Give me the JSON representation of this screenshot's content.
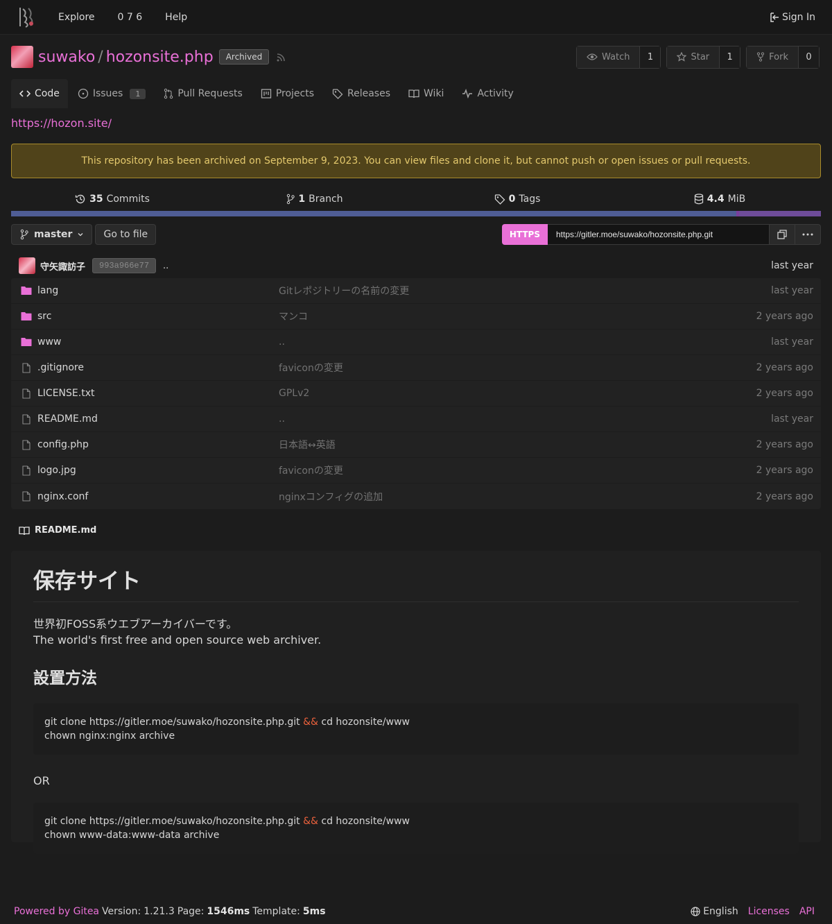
{
  "nav": {
    "explore": "Explore",
    "numbers": "0 7 6",
    "help": "Help",
    "signin": "Sign In"
  },
  "repo": {
    "owner": "suwako",
    "sep": "/",
    "name": "hozonsite.php",
    "archived_badge": "Archived",
    "watch_label": "Watch",
    "watch_count": "1",
    "star_label": "Star",
    "star_count": "1",
    "fork_label": "Fork",
    "fork_count": "0"
  },
  "tabs": [
    {
      "label": "Code",
      "icon": "code-icon"
    },
    {
      "label": "Issues",
      "count": "1",
      "icon": "issue-icon"
    },
    {
      "label": "Pull Requests",
      "icon": "pull-request-icon"
    },
    {
      "label": "Projects",
      "icon": "projects-icon"
    },
    {
      "label": "Releases",
      "icon": "tag-icon"
    },
    {
      "label": "Wiki",
      "icon": "book-icon"
    },
    {
      "label": "Activity",
      "icon": "pulse-icon"
    }
  ],
  "website": "https://hozon.site/",
  "archived_notice": "This repository has been archived on September 9, 2023. You can view files and clone it, but cannot push or open issues or pull requests.",
  "stats": {
    "commits_num": "35",
    "commits_label": "Commits",
    "branch_num": "1",
    "branch_label": "Branch",
    "tags_num": "0",
    "tags_label": "Tags",
    "size_num": "4.4",
    "size_label": "MiB"
  },
  "language_bar": [
    {
      "color": "#4f5d95",
      "fraction": 0.8956
    },
    {
      "color": "#7a3e9d",
      "fraction": 0.0035
    },
    {
      "color": "#6e4c99",
      "fraction": 0.1009
    }
  ],
  "branch": {
    "current": "master",
    "goto_file": "Go to file",
    "protocol": "HTTPS",
    "clone_url": "https://gitler.moe/suwako/hozonsite.php.git"
  },
  "latest_commit": {
    "author": "守矢諏訪子",
    "sha": "993a966e77",
    "message": "..",
    "age": "last year"
  },
  "files": [
    {
      "name": "lang",
      "type": "folder",
      "message": "Gitレポジトリーの名前の変更",
      "age": "last year"
    },
    {
      "name": "src",
      "type": "folder",
      "message": "マンコ",
      "age": "2 years ago"
    },
    {
      "name": "www",
      "type": "folder",
      "message": "..",
      "age": "last year"
    },
    {
      "name": ".gitignore",
      "type": "file",
      "message": "faviconの変更",
      "age": "2 years ago"
    },
    {
      "name": "LICENSE.txt",
      "type": "file",
      "message": "GPLv2",
      "age": "2 years ago"
    },
    {
      "name": "README.md",
      "type": "file",
      "message": "..",
      "age": "last year"
    },
    {
      "name": "config.php",
      "type": "file",
      "message": "日本語↔英語",
      "age": "2 years ago"
    },
    {
      "name": "logo.jpg",
      "type": "file",
      "message": "faviconの変更",
      "age": "2 years ago"
    },
    {
      "name": "nginx.conf",
      "type": "file",
      "message": "nginxコンフィグの追加",
      "age": "2 years ago"
    }
  ],
  "readme": {
    "filename": "README.md",
    "h1": "保存サイト",
    "p_line1": "世界初FOSS系ウエブアーカイバーです。",
    "p_line2": "The world's first free and open source web archiver.",
    "h2": "設置方法",
    "code1": {
      "line1_a": "git clone https://gitler.moe/suwako/hozonsite.php.git ",
      "amp": "&&",
      "line1_b": " cd hozonsite/www",
      "line2": "chown nginx:nginx archive"
    },
    "or": "OR",
    "code2": {
      "line1_a": "git clone https://gitler.moe/suwako/hozonsite.php.git ",
      "amp": "&&",
      "line1_b": " cd hozonsite/www",
      "line2": "chown www-data:www-data archive"
    }
  },
  "footer": {
    "powered": "Powered by Gitea",
    "version_label": "Version:",
    "version": "1.21.3",
    "page_label": "Page:",
    "page_time": "1546ms",
    "template_label": "Template:",
    "template_time": "5ms",
    "language": "English",
    "licenses": "Licenses",
    "api": "API"
  }
}
